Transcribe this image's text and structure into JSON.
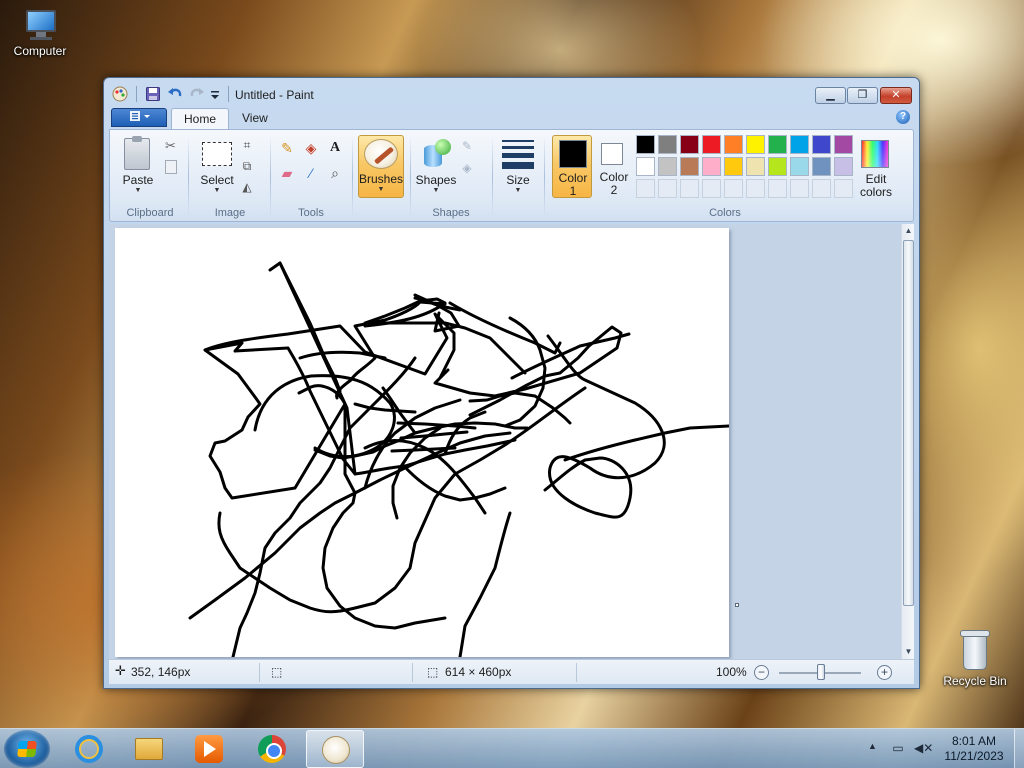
{
  "desktop": {
    "icons": [
      {
        "label": "Computer",
        "icon": "computer-icon"
      },
      {
        "label": "Recycle Bin",
        "icon": "recycle-bin-icon"
      }
    ]
  },
  "window": {
    "title": "Untitled - Paint",
    "tabs": [
      {
        "label": "Home",
        "active": true
      },
      {
        "label": "View",
        "active": false
      }
    ],
    "help_label": "?"
  },
  "ribbon": {
    "groups": {
      "clipboard": "Clipboard",
      "image": "Image",
      "tools": "Tools",
      "shapes": "Shapes",
      "colors": "Colors"
    },
    "buttons": {
      "paste": "Paste",
      "select": "Select",
      "brushes": "Brushes",
      "shapes": "Shapes",
      "size": "Size",
      "color1_line1": "Color",
      "color1_line2": "1",
      "color2_line1": "Color",
      "color2_line2": "2",
      "edit_colors_line1": "Edit",
      "edit_colors_line2": "colors"
    },
    "color1": "#000000",
    "color2": "#ffffff",
    "palette_row1": [
      "#000000",
      "#7f7f7f",
      "#880015",
      "#ed1c24",
      "#ff7f27",
      "#fff200",
      "#22b14c",
      "#00a2e8",
      "#3f48cc",
      "#a349a4"
    ],
    "palette_row2": [
      "#ffffff",
      "#c3c3c3",
      "#b97a57",
      "#ffaec9",
      "#ffc90e",
      "#efe4b0",
      "#b5e61d",
      "#99d9ea",
      "#7092be",
      "#c8bfe7"
    ],
    "palette_row3_empty": 10
  },
  "status": {
    "cursor_position": "352, 146px",
    "canvas_size": "614 × 460px",
    "zoom": "100%",
    "zoom_level": 1.0
  },
  "taskbar": {
    "apps": [
      "internet-explorer-icon",
      "windows-explorer-icon",
      "media-player-icon",
      "chrome-icon",
      "paint-icon"
    ],
    "active_app": "paint-icon",
    "time": "8:01 AM",
    "date": "11/21/2023"
  },
  "colors": {
    "window_frame": "#b4cbe6",
    "ribbon_active_button": "#f8c866",
    "canvas_background": "#c4d3e6"
  }
}
